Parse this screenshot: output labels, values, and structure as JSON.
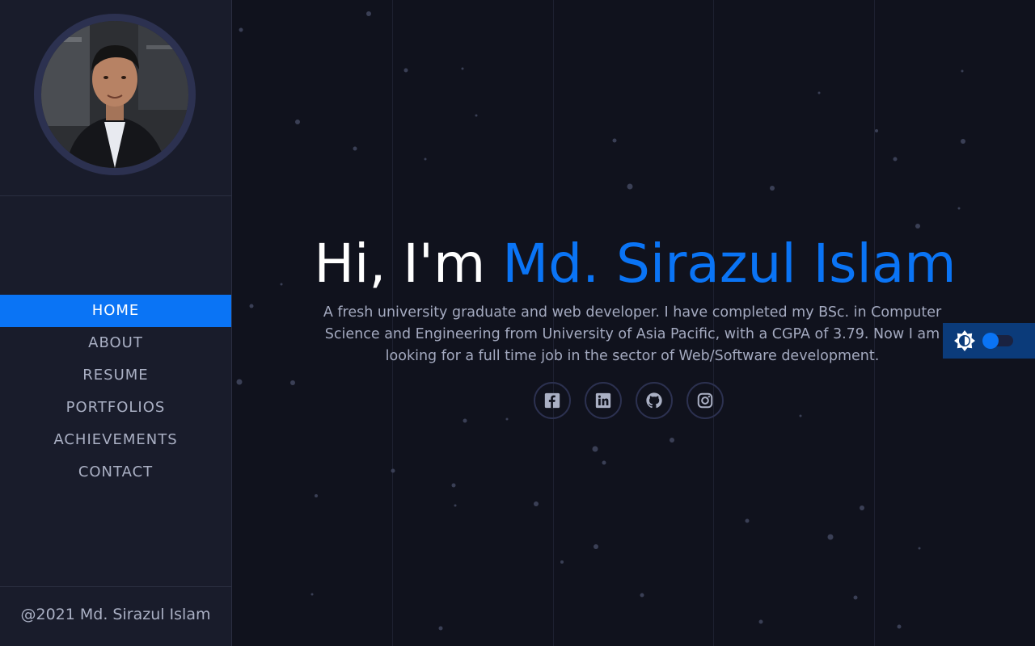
{
  "sidebar": {
    "avatar_alt": "Profile photo",
    "nav_items": [
      {
        "label": "HOME",
        "active": true
      },
      {
        "label": "ABOUT",
        "active": false
      },
      {
        "label": "RESUME",
        "active": false
      },
      {
        "label": "PORTFOLIOS",
        "active": false
      },
      {
        "label": "ACHIEVEMENTS",
        "active": false
      },
      {
        "label": "CONTACT",
        "active": false
      }
    ],
    "copyright": "@2021 Md. Sirazul Islam"
  },
  "hero": {
    "greeting": "Hi, I'm ",
    "name": "Md. Sirazul Islam",
    "bio": "A fresh university graduate and web developer. I have completed my BSc. in Computer Science and Engineering from University of Asia Pacific, with a CGPA of 3.79. Now I am looking for a full time job in the sector of Web/Software development."
  },
  "socials": [
    {
      "name": "facebook",
      "icon": "facebook-icon"
    },
    {
      "name": "linkedin",
      "icon": "linkedin-icon"
    },
    {
      "name": "github",
      "icon": "github-icon"
    },
    {
      "name": "instagram",
      "icon": "instagram-icon"
    }
  ],
  "theme_toggle": {
    "icon": "brightness-icon",
    "state": "dark"
  },
  "colors": {
    "accent": "#0a74f5",
    "background": "#10121d",
    "sidebar": "#191c2b",
    "text_muted": "#a4aac0"
  }
}
